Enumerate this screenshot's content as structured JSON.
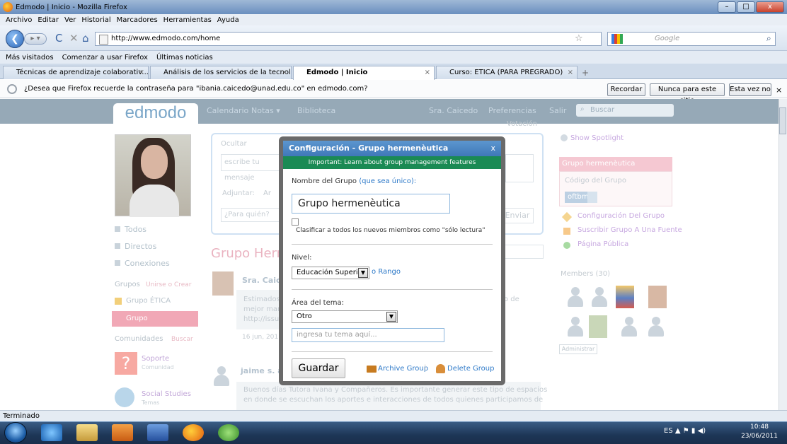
{
  "window": {
    "title": "Edmodo | Inicio - Mozilla Firefox",
    "min": "–",
    "max": "□",
    "close": "x"
  },
  "menu": [
    "Archivo",
    "Editar",
    "Ver",
    "Historial",
    "Marcadores",
    "Herramientas",
    "Ayuda"
  ],
  "nav": {
    "url": "http://www.edmodo.com/home",
    "search_placeholder": "Google",
    "star": "☆",
    "reload": "C",
    "stop": "✕",
    "home": "⌂"
  },
  "bookmarks": [
    "Más visitados",
    "Comenzar a usar Firefox",
    "Últimas noticias"
  ],
  "tabs": [
    {
      "label": "Técnicas de aprendizaje colaborativ...",
      "close": "×"
    },
    {
      "label": "Análisis de los servicios de la tecnol...",
      "close": "×"
    },
    {
      "label": "Edmodo | Inicio",
      "close": "×"
    },
    {
      "label": "Curso: ETICA (PARA PREGRADO)",
      "close": "×"
    }
  ],
  "new_tab": "+",
  "password_bar": {
    "message": "¿Desea que Firefox recuerde la contraseña para \"ibania.caicedo@unad.edu.co\" en edmodo.com?",
    "remember": "Recordar",
    "never": "Nunca para este sitio",
    "not_now": "Esta vez no",
    "close": "×"
  },
  "edmodo": {
    "logo": "edmodo",
    "nav": [
      "Calendario",
      "Notas ▾",
      "Biblioteca"
    ],
    "user": "Sra. Caicedo",
    "prefs": "Preferencias",
    "logout": "Salir",
    "search": "Buscar"
  },
  "sidebar": {
    "items": [
      "Todos",
      "Directos",
      "Conexiones"
    ],
    "groups_label": "Grupos",
    "groups_action": "Unirse o Crear",
    "groups": [
      "Grupo ÉTICA",
      "Grupo hermenèutica"
    ],
    "communities_label": "Comunidades",
    "communities_action": "Buscar",
    "communities": [
      {
        "name": "Soporte",
        "sub": "Comunidad"
      },
      {
        "name": "Social Studies",
        "sub": "Temas"
      }
    ]
  },
  "post": {
    "hide": "Ocultar",
    "placeholder": "escribe tu mensaje",
    "attach": "Adjuntar:",
    "attach_item": "Ar",
    "to": "¿Para quién?",
    "send": "Enviar",
    "poll": "Votación"
  },
  "feed": {
    "heading": "Grupo Herm",
    "post1_author": "Sra. Caice",
    "post1_text1": "Estimados",
    "post1_text2": "mejor man",
    "post1_text3": "http://issu",
    "post1_text4": "o de",
    "post1_date": "16 jun, 2011",
    "post2_author": "jaime s. a",
    "post2_text1": "Buenos días Tutora Ivana y Compañeros. Es importante generar este tipo de espacios",
    "post2_text2": "en donde se escuchan los aportes e interacciones de todos quienes participamos de"
  },
  "right": {
    "spotlight": "Show Spotlight",
    "group_title": "Grupo hermenèutica",
    "code_label": "Código del Grupo",
    "code": "oftbmx",
    "links": [
      "Configuración Del Grupo",
      "Suscribir Grupo A Una Fuente",
      "Página Pública"
    ],
    "members": "Members (30)",
    "admin": "Administrar"
  },
  "modal": {
    "title": "Configuración - Grupo hermenèutica",
    "close": "x",
    "banner": "Important: Learn about group management features",
    "name_label": "Nombre del Grupo",
    "name_hint": "(que sea único):",
    "name_value": "Grupo hermenèutica",
    "readonly_label": "Clasificar a todos los nuevos miembros como \"sólo lectura\"",
    "level_label": "Nivel:",
    "level_value": "Educación Superior",
    "level_or": "o",
    "level_range": "Rango",
    "area_label": "Área del tema:",
    "area_value": "Otro",
    "topic_placeholder": "ingresa tu tema aquí...",
    "save": "Guardar",
    "archive": "Archive Group",
    "separator": "|",
    "delete": "Delete Group"
  },
  "status": "Terminado",
  "taskbar": {
    "lang": "ES",
    "time": "10:48",
    "date": "23/06/2011"
  }
}
